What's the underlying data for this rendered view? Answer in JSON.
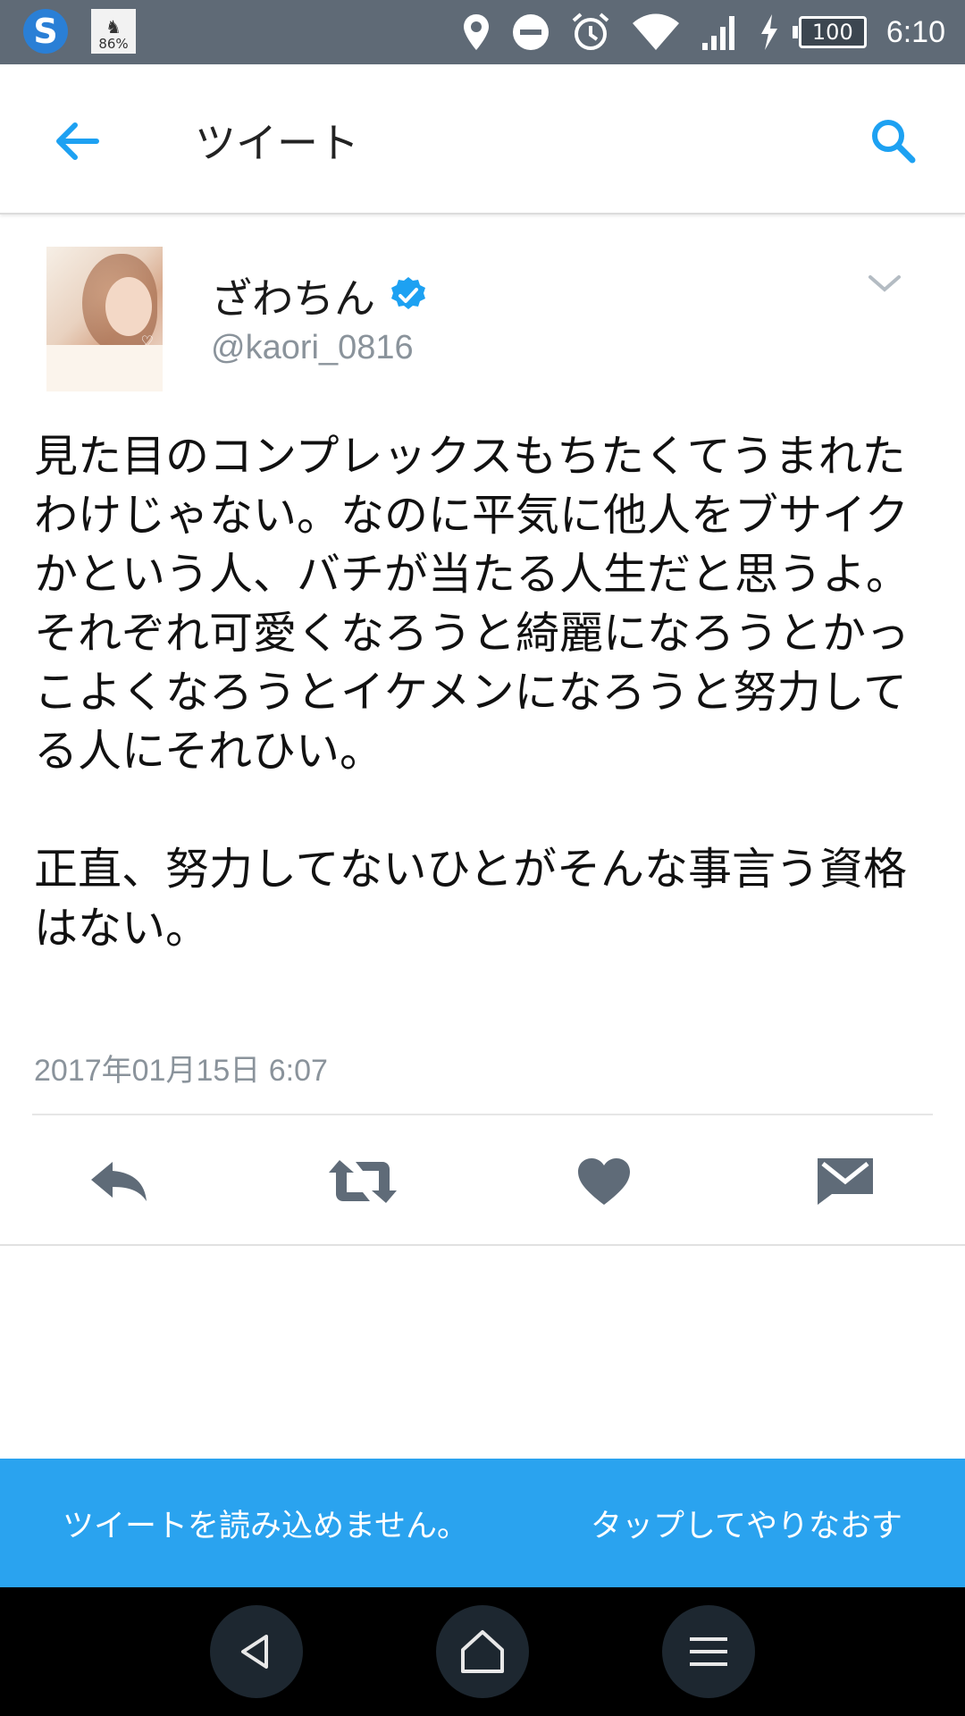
{
  "status_bar": {
    "left_app_letter": "S",
    "left_badge_percent": "86%",
    "battery": "100",
    "time": "6:10"
  },
  "appbar": {
    "title": "ツイート"
  },
  "tweet": {
    "display_name": "ざわちん",
    "handle": "@kaori_0816",
    "text": "見た目のコンプレックスもちたくてうまれたわけじゃない。なのに平気に他人をブサイクかという人、バチが当たる人生だと思うよ。\nそれぞれ可愛くなろうと綺麗になろうとかっこよくなろうとイケメンになろうと努力してる人にそれひい。\n\n正直、努力してないひとがそんな事言う資格はない。",
    "timestamp": "2017年01月15日 6:07"
  },
  "banner": {
    "message": "ツイートを読み込めません。",
    "retry": "タップしてやりなおす"
  },
  "colors": {
    "accent": "#1da1f2",
    "banner": "#2aa3ef",
    "icon_gray": "#5f6b78",
    "status_bar": "#5f6a76"
  }
}
